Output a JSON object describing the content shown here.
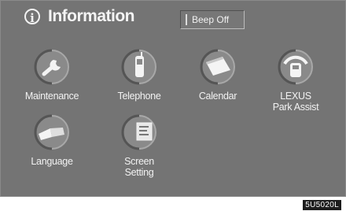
{
  "header": {
    "title": "Information",
    "info_icon": "info-circle-icon"
  },
  "beep_button": {
    "label": "Beep Off"
  },
  "menu": [
    {
      "id": "maintenance",
      "label": "Maintenance",
      "icon": "wrench-icon"
    },
    {
      "id": "telephone",
      "label": "Telephone",
      "icon": "phone-icon"
    },
    {
      "id": "calendar",
      "label": "Calendar",
      "icon": "calendar-icon"
    },
    {
      "id": "park-assist",
      "label": "LEXUS\nPark Assist",
      "icon": "park-assist-icon"
    },
    {
      "id": "language",
      "label": "Language",
      "icon": "book-icon"
    },
    {
      "id": "screen-setting",
      "label": "Screen\nSetting",
      "icon": "screen-setting-icon"
    }
  ],
  "figure_code": "5U5020L",
  "colors": {
    "screen_bg": "#747474",
    "text": "#f2f2f2"
  }
}
